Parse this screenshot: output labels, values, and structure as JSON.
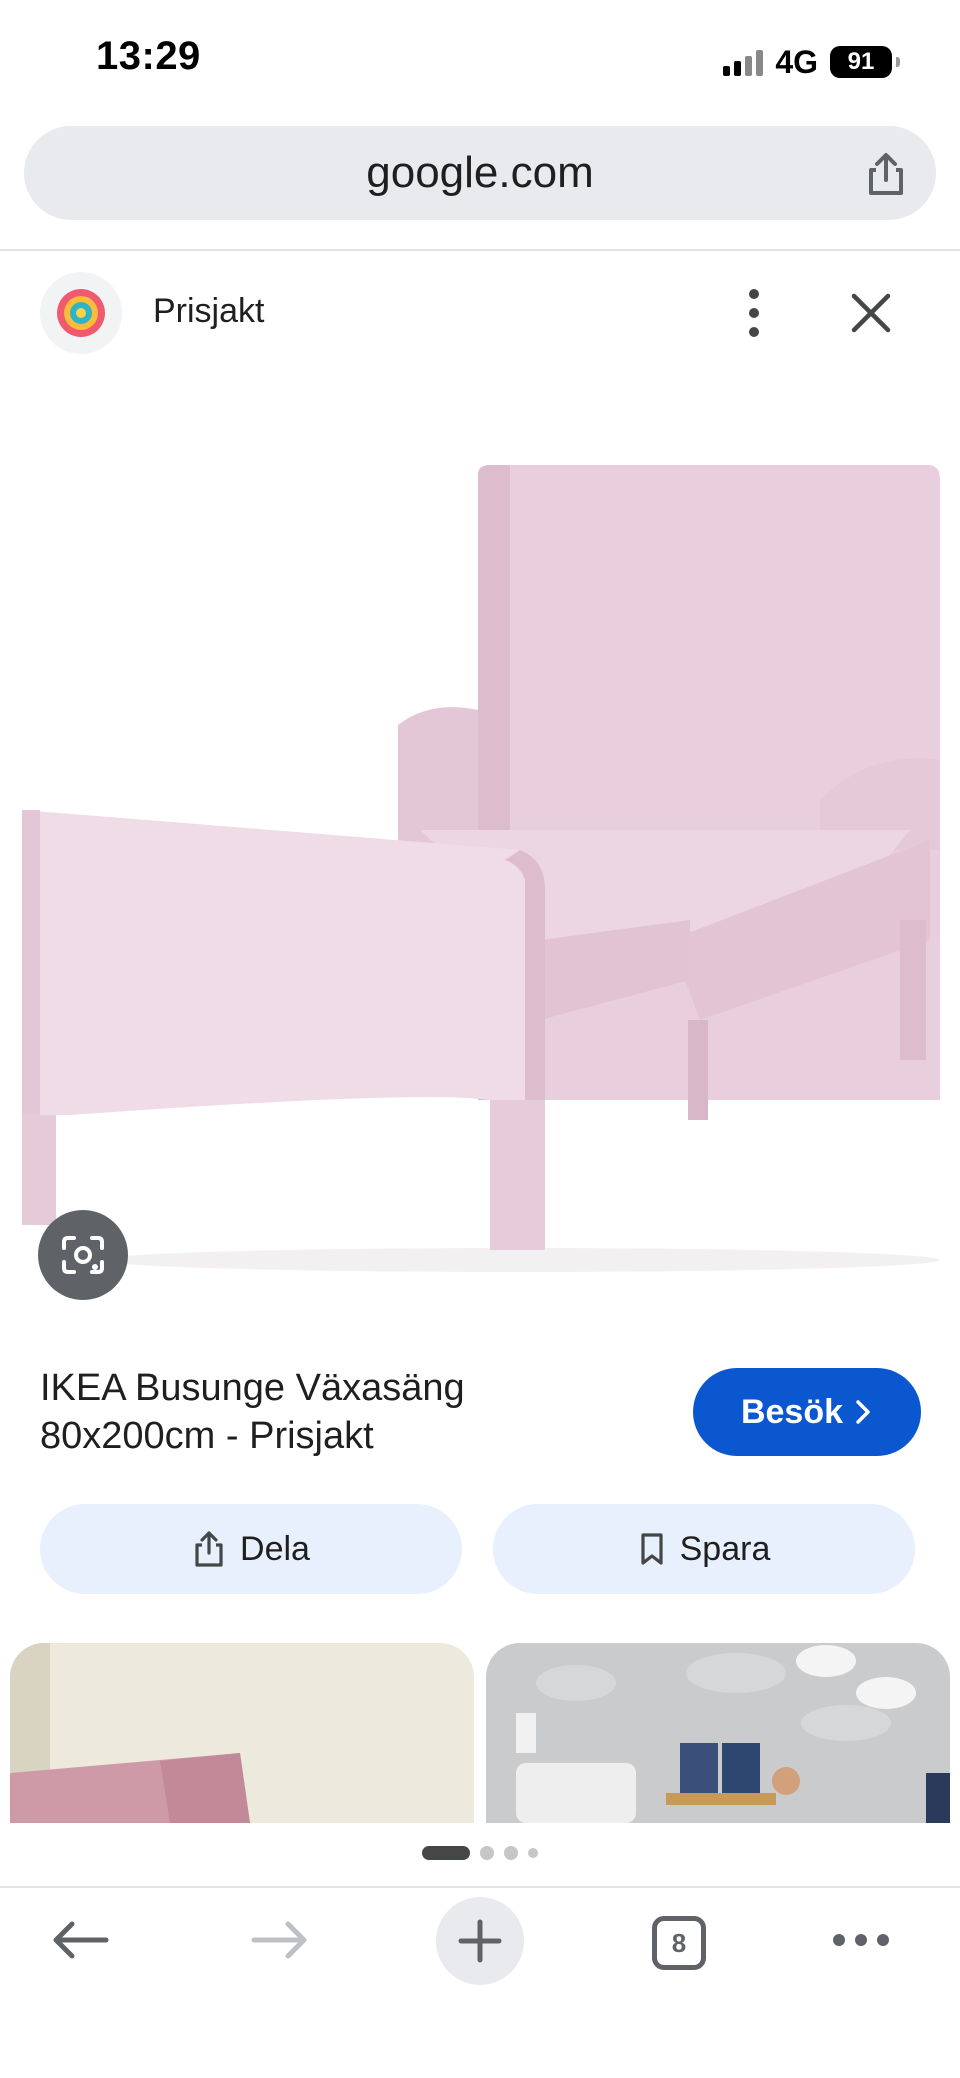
{
  "status_bar": {
    "time": "13:29",
    "network": "4G",
    "battery": "91"
  },
  "browser": {
    "url": "google.com"
  },
  "source": {
    "name": "Prisjakt"
  },
  "product": {
    "title_line1": "IKEA Busunge Växasäng",
    "title_line2": "80x200cm - Prisjakt",
    "visit_label": "Besök"
  },
  "actions": {
    "share_label": "Dela",
    "save_label": "Spara"
  },
  "tabs": {
    "count": "8"
  },
  "colors": {
    "accent": "#0b57d0",
    "chip_bg": "#e8f0fe",
    "bed_pink": "#e8cfdd"
  },
  "icons": [
    "share-icon",
    "more-vert-icon",
    "close-icon",
    "lens-icon",
    "chevron-right-icon",
    "bookmark-icon",
    "back-arrow-icon",
    "forward-arrow-icon",
    "plus-icon",
    "more-horiz-icon"
  ]
}
